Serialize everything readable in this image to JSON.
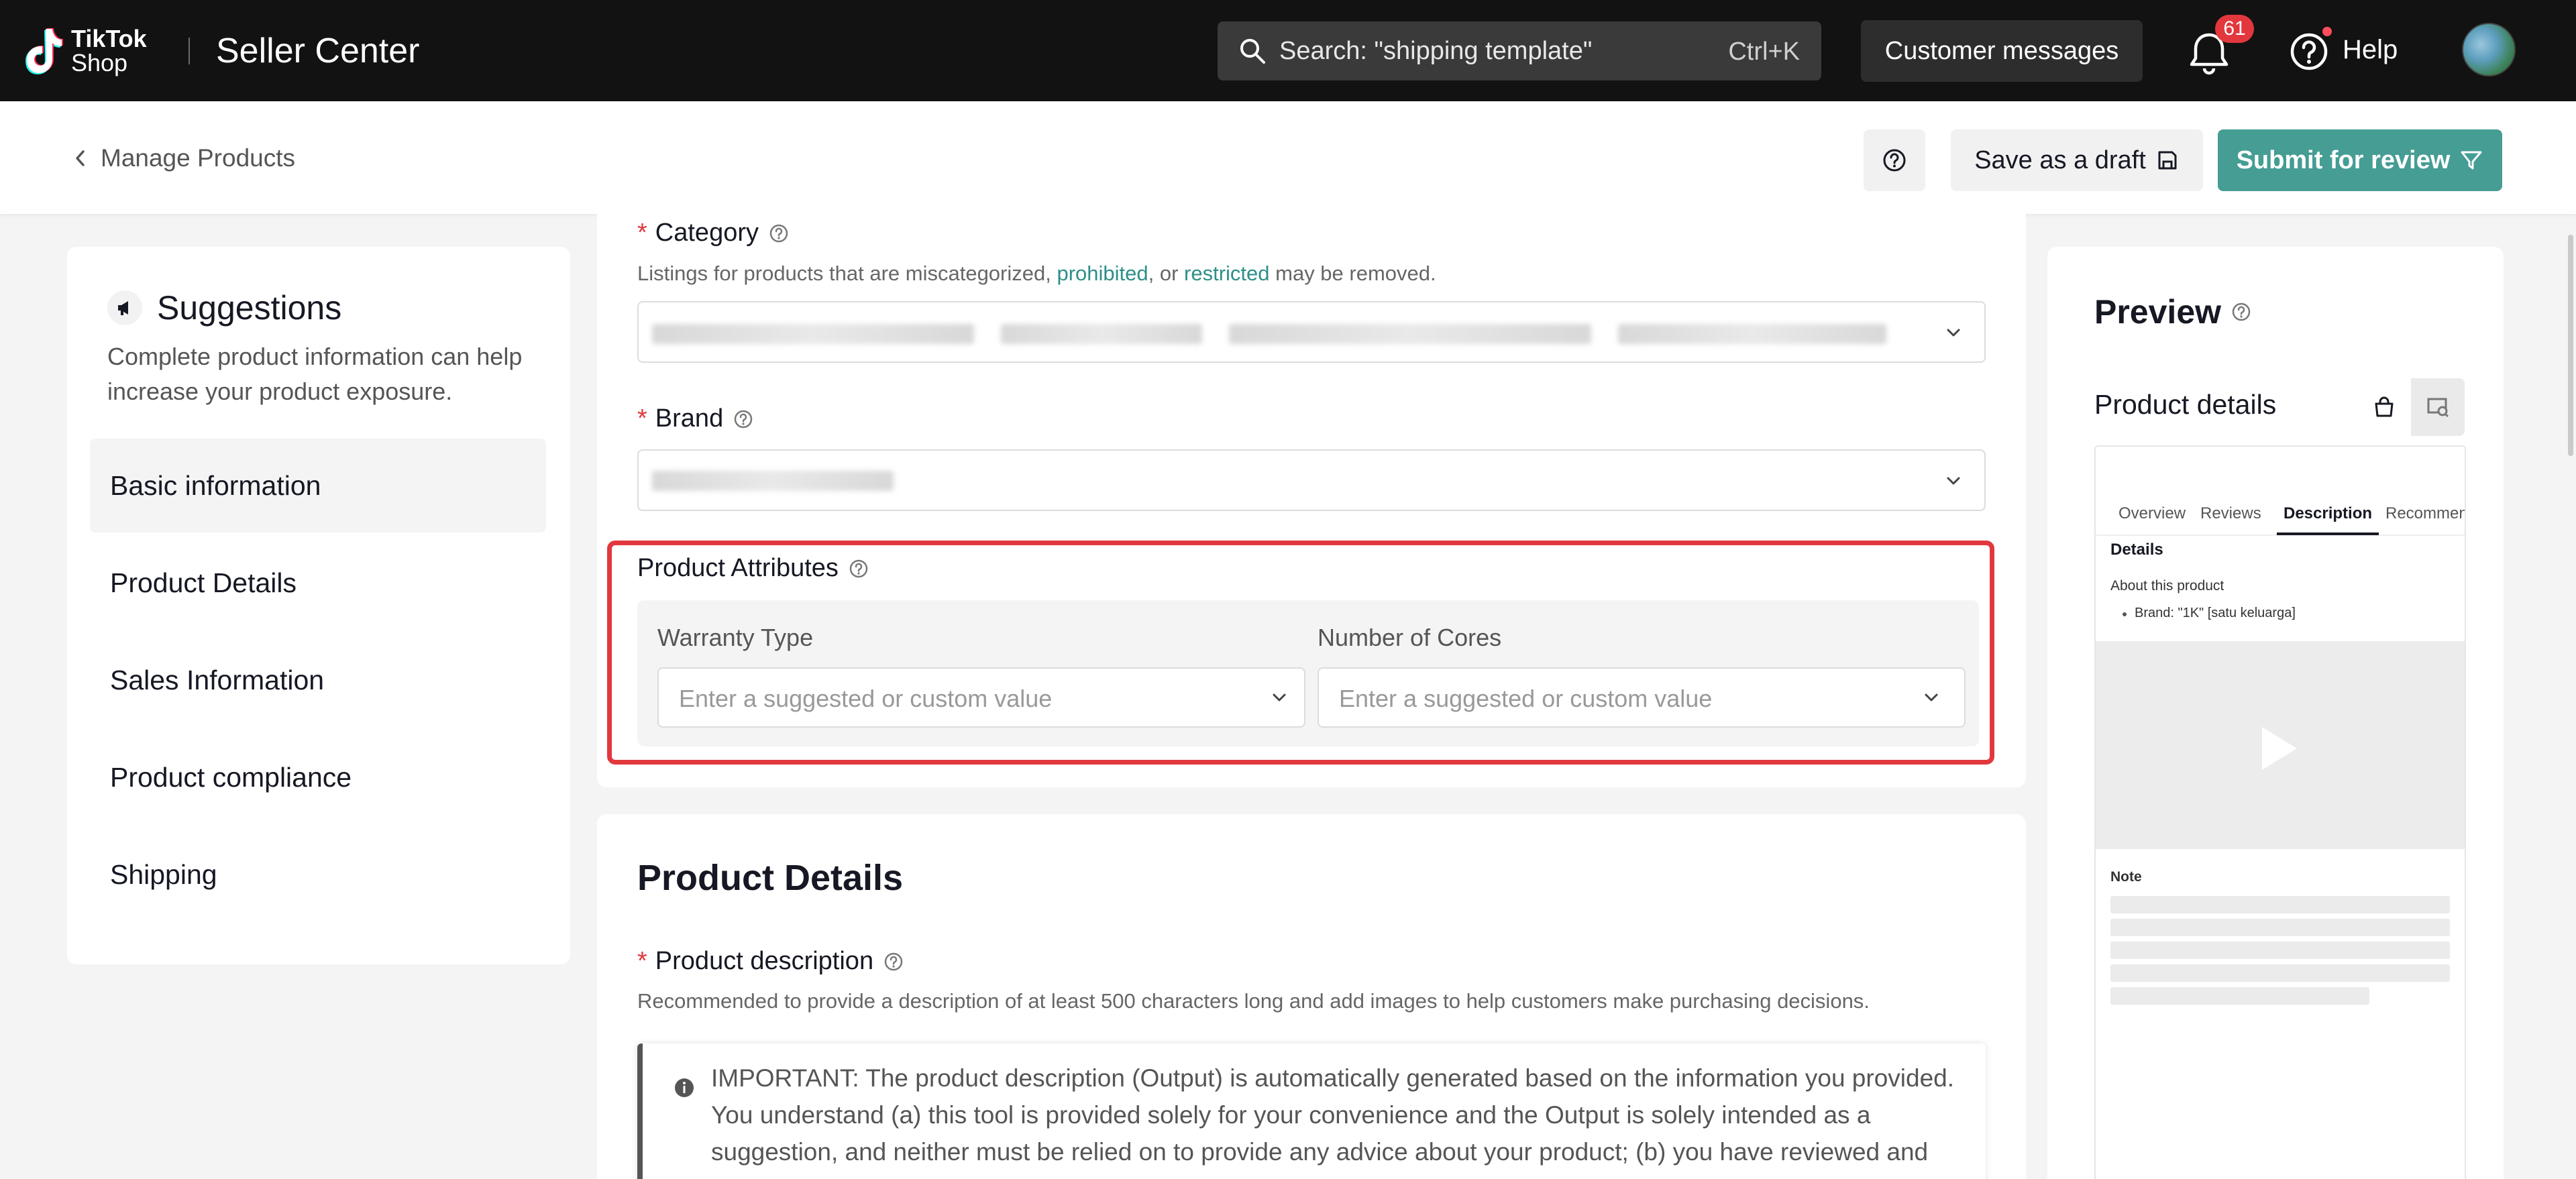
{
  "topbar": {
    "logo_text_line1": "TikTok",
    "logo_text_line2": "Shop",
    "app_title": "Seller Center",
    "search_placeholder": "Search: \"shipping template\"",
    "search_shortcut": "Ctrl+K",
    "customer_messages": "Customer messages",
    "notification_count": "61",
    "help_label": "Help"
  },
  "subheader": {
    "back_label": "Manage Products",
    "save_draft_label": "Save as a draft",
    "submit_label": "Submit for review"
  },
  "suggestions": {
    "title": "Suggestions",
    "description": "Complete product information can help increase your product exposure.",
    "nav": [
      {
        "label": "Basic information",
        "active": true
      },
      {
        "label": "Product Details",
        "active": false
      },
      {
        "label": "Sales Information",
        "active": false
      },
      {
        "label": "Product compliance",
        "active": false
      },
      {
        "label": "Shipping",
        "active": false
      }
    ]
  },
  "form": {
    "category_label": "Category",
    "category_help_prefix": "Listings for products that are miscategorized, ",
    "category_help_link1": "prohibited",
    "category_help_mid": ", or ",
    "category_help_link2": "restricted",
    "category_help_suffix": " may be removed.",
    "brand_label": "Brand",
    "attributes_label": "Product Attributes",
    "warranty_label": "Warranty Type",
    "warranty_placeholder": "Enter a suggested or custom value",
    "cores_label": "Number of Cores",
    "cores_placeholder": "Enter a suggested or custom value",
    "product_details_title": "Product Details",
    "description_label": "Product description",
    "description_help": "Recommended to provide a description of at least 500 characters long and add images to help customers make purchasing decisions.",
    "notice_text": "IMPORTANT: The product description (Output) is automatically generated based on the information you provided. You understand (a) this tool is provided solely for your convenience and the Output is solely intended as a suggestion, and neither must be relied on to provide any advice about your product; (b) you have reviewed and"
  },
  "preview": {
    "title": "Preview",
    "product_details": "Product details",
    "tabs": [
      "Overview",
      "Reviews",
      "Description",
      "Recommen"
    ],
    "selected_tab": "Description",
    "details_heading": "Details",
    "about_heading": "About this product",
    "brand_line": "Brand: \"1K\" [satu keluarga]",
    "note_heading": "Note"
  },
  "colors": {
    "accent": "#459d94",
    "highlight_box": "#e2383d",
    "link": "#2d8f88",
    "topbar": "#121212"
  }
}
